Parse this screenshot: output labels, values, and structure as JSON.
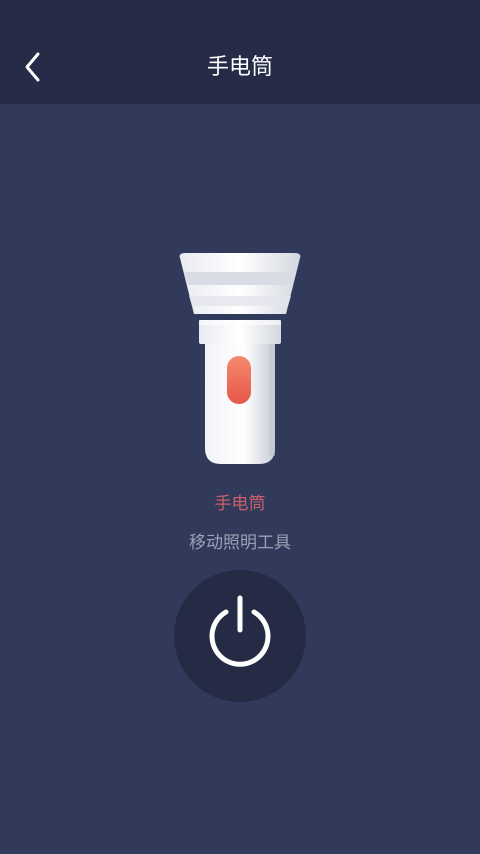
{
  "header": {
    "title": "手电筒",
    "back_icon": "chevron-left-icon"
  },
  "main": {
    "illustration": "flashlight-icon",
    "app_name": "手电筒",
    "app_description": "移动照明工具",
    "power_icon": "power-icon"
  },
  "colors": {
    "background": "#313a5a",
    "header_bg": "#262c47",
    "accent": "#c7606a",
    "button_bg": "#252b45"
  }
}
